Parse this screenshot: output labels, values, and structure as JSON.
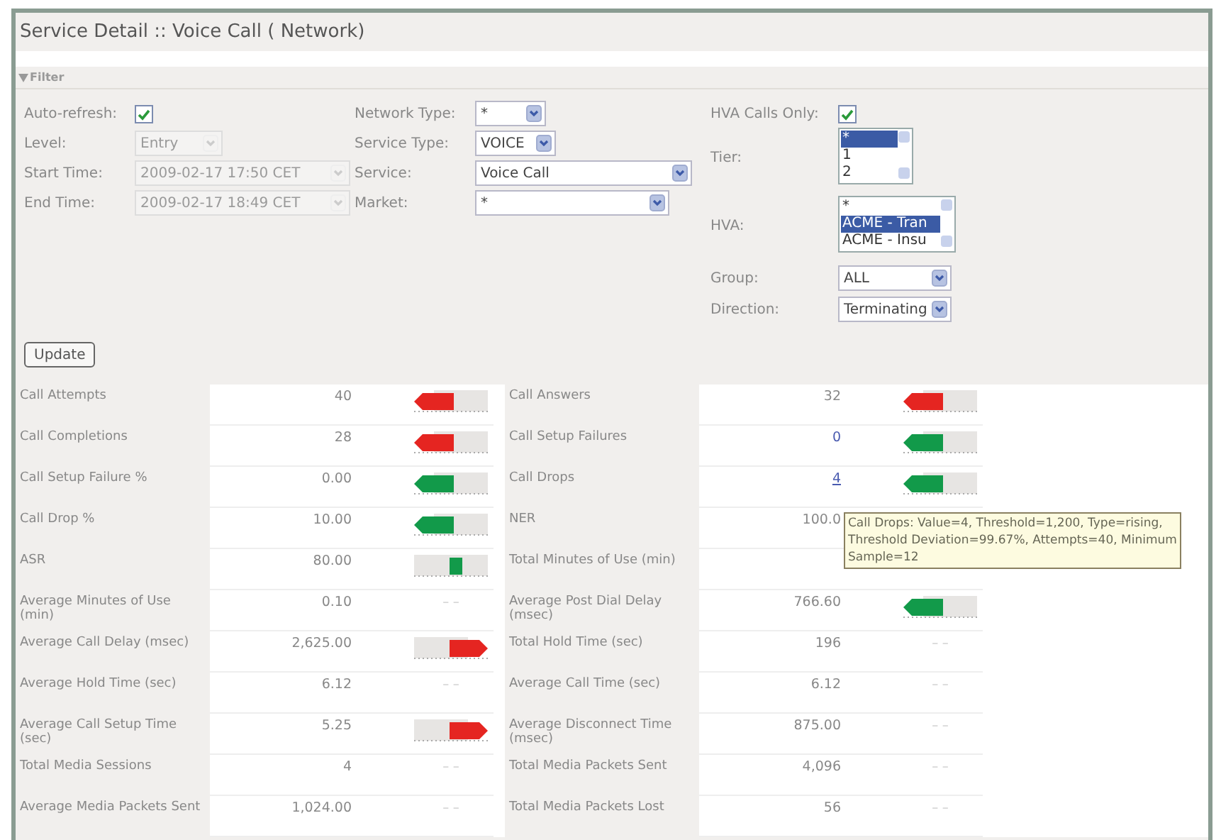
{
  "window": {
    "title": "Service Detail :: Voice Call ( Network)"
  },
  "filter": {
    "header": "Filter",
    "expanded": true,
    "columns": [
      [
        {
          "kind": "checkbox",
          "label": "Auto-refresh:",
          "checked": true
        },
        {
          "kind": "select",
          "label": "Level:",
          "value": "Entry",
          "disabled": true
        },
        {
          "kind": "select",
          "label": "Start Time:",
          "value": "2009-02-17 17:50 CET",
          "disabled": true
        },
        {
          "kind": "select",
          "label": "End Time:",
          "value": "2009-02-17 18:49 CET",
          "disabled": true
        }
      ],
      [
        {
          "kind": "select",
          "label": "Network Type:",
          "value": "*",
          "disabled": false
        },
        {
          "kind": "select",
          "label": "Service Type:",
          "value": "VOICE",
          "disabled": false
        },
        {
          "kind": "select",
          "label": "Service:",
          "value": "Voice Call",
          "disabled": false
        },
        {
          "kind": "select",
          "label": "Market:",
          "value": "*",
          "disabled": false
        }
      ],
      [
        {
          "kind": "checkbox",
          "label": "HVA Calls Only:",
          "checked": true
        },
        {
          "kind": "listbox",
          "label": "Tier:",
          "options": [
            {
              "text": "*",
              "selected": true
            },
            {
              "text": "1",
              "selected": false
            },
            {
              "text": "2",
              "selected": false
            }
          ]
        },
        {
          "kind": "listbox",
          "label": "HVA:",
          "options": [
            {
              "text": "*",
              "selected": false
            },
            {
              "text": "ACME - Tran",
              "selected": true
            },
            {
              "text": "ACME - Insu",
              "selected": false
            }
          ]
        },
        {
          "kind": "select",
          "label": "Group:",
          "value": "ALL",
          "disabled": false
        },
        {
          "kind": "select",
          "label": "Direction:",
          "value": "Terminating",
          "disabled": false
        }
      ]
    ],
    "update_button": "Update"
  },
  "metrics": [
    [
      {
        "label": "Call Attempts",
        "value": "40",
        "indicator": {
          "kind": "arrow-left",
          "color": "#e52521"
        }
      },
      {
        "label": "Call Answers",
        "value": "32",
        "indicator": {
          "kind": "arrow-left",
          "color": "#e52521"
        }
      }
    ],
    [
      {
        "label": "Call Completions",
        "value": "28",
        "indicator": {
          "kind": "arrow-left",
          "color": "#e52521"
        }
      },
      {
        "label": "Call Setup Failures",
        "value": "0",
        "link": true,
        "indicator": {
          "kind": "arrow-left",
          "color": "#129a4a"
        }
      }
    ],
    [
      {
        "label": "Call Setup Failure %",
        "value": "0.00",
        "indicator": {
          "kind": "arrow-left",
          "color": "#129a4a"
        }
      },
      {
        "label": "Call Drops",
        "value": "4",
        "link": true,
        "hovered": true,
        "indicator": {
          "kind": "arrow-left",
          "color": "#129a4a"
        }
      }
    ],
    [
      {
        "label": "Call Drop %",
        "value": "10.00",
        "indicator": {
          "kind": "arrow-left",
          "color": "#129a4a"
        }
      },
      {
        "label": "NER",
        "value": "100.0"
      }
    ],
    [
      {
        "label": "ASR",
        "value": "80.00",
        "indicator": {
          "kind": "block",
          "color": "#129a4a"
        }
      },
      {
        "label": "Total Minutes of Use (min)"
      }
    ],
    [
      {
        "label": "Average Minutes of Use (min)",
        "value": "0.10",
        "indicator": {
          "kind": "none",
          "text": "– –"
        }
      },
      {
        "label": "Average Post Dial Delay (msec)",
        "value": "766.60",
        "indicator": {
          "kind": "arrow-left",
          "color": "#129a4a"
        }
      }
    ],
    [
      {
        "label": "Average Call Delay (msec)",
        "value": "2,625.00",
        "indicator": {
          "kind": "arrow-right",
          "color": "#e52521"
        }
      },
      {
        "label": "Total Hold Time (sec)",
        "value": "196",
        "indicator": {
          "kind": "none",
          "text": "– –"
        }
      }
    ],
    [
      {
        "label": "Average Hold Time (sec)",
        "value": "6.12",
        "indicator": {
          "kind": "none",
          "text": "– –"
        }
      },
      {
        "label": "Average Call Time (sec)",
        "value": "6.12",
        "indicator": {
          "kind": "none",
          "text": "– –"
        }
      }
    ],
    [
      {
        "label": "Average Call Setup Time (sec)",
        "value": "5.25",
        "indicator": {
          "kind": "arrow-right",
          "color": "#e52521"
        }
      },
      {
        "label": "Average Disconnect Time (msec)",
        "value": "875.00",
        "indicator": {
          "kind": "none",
          "text": "– –"
        }
      }
    ],
    [
      {
        "label": "Total Media Sessions",
        "value": "4",
        "indicator": {
          "kind": "none",
          "text": "– –"
        }
      },
      {
        "label": "Total Media Packets Sent",
        "value": "4,096",
        "indicator": {
          "kind": "none",
          "text": "– –"
        }
      }
    ],
    [
      {
        "label": "Average Media Packets Sent",
        "value": "1,024.00",
        "indicator": {
          "kind": "none",
          "text": "– –"
        }
      },
      {
        "label": "Total Media Packets Lost",
        "value": "56",
        "indicator": {
          "kind": "none",
          "text": "– –"
        }
      }
    ]
  ],
  "tooltip": {
    "lines": [
      "Call Drops: Value=4, Threshold=1,200, Type=rising,",
      "Threshold Deviation=99.67%, Attempts=40, Minimum",
      "Sample=12"
    ]
  }
}
